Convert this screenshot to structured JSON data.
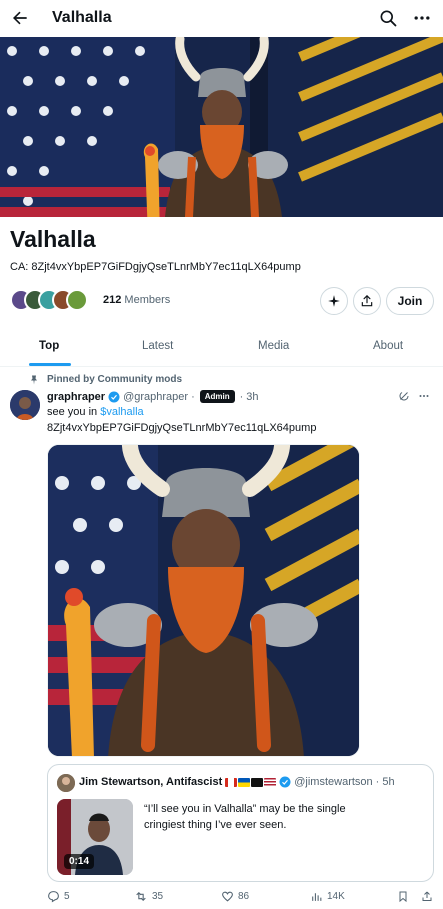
{
  "topbar": {
    "title": "Valhalla",
    "back_icon": "back-arrow-icon",
    "search_icon": "search-icon",
    "more_icon": "more-icon"
  },
  "community": {
    "name": "Valhalla",
    "ca": "CA: 8Zjt4vxYbpEP7GiFDgjyQseTLnrMbY7ec11qLX64pump",
    "members_count": "212",
    "members_label": "Members",
    "join_label": "Join"
  },
  "tabs": [
    {
      "label": "Top",
      "active": true
    },
    {
      "label": "Latest",
      "active": false
    },
    {
      "label": "Media",
      "active": false
    },
    {
      "label": "About",
      "active": false
    }
  ],
  "post": {
    "pinned_label": "Pinned by Community mods",
    "author_name": "graphraper",
    "author_handle": "@graphraper",
    "dot": "·",
    "badge": "Admin",
    "time": "3h",
    "text_prefix": "see you in",
    "text_link": "$valhalla",
    "text_line2": "8Zjt4vxYbpEP7GiFDgjyQseTLnrMbY7ec11qLX64pump"
  },
  "quote": {
    "author_name": "Jim Stewartson, Antifascist",
    "author_handle": "@jimstewartson",
    "dot": "·",
    "time": "5h",
    "text": "“I’ll see you in Valhalla” may be the single cringiest thing I’ve ever seen.",
    "video_duration": "0:14"
  },
  "actions": {
    "replies": "5",
    "reposts": "35",
    "likes": "86",
    "views": "14K"
  },
  "colors": {
    "accent": "#1d9bf0",
    "text": "#0f1419",
    "muted": "#536471",
    "border": "#cfd9de"
  }
}
